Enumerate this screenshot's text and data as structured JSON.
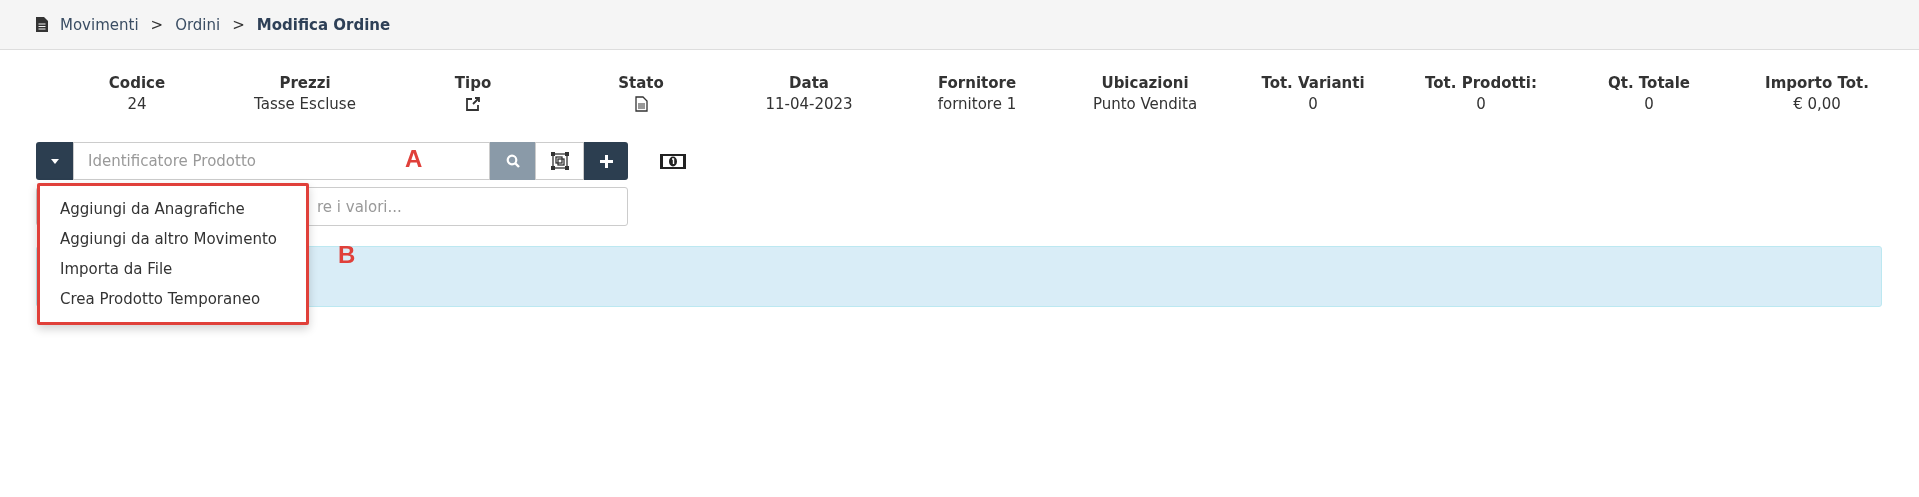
{
  "breadcrumb": [
    {
      "label": "Movimenti",
      "current": false
    },
    {
      "label": "Ordini",
      "current": false
    },
    {
      "label": "Modifica Ordine",
      "current": true
    }
  ],
  "summary": [
    {
      "label": "Codice",
      "kind": "text",
      "value": "24"
    },
    {
      "label": "Prezzi",
      "kind": "text",
      "value": "Tasse Escluse"
    },
    {
      "label": "Tipo",
      "kind": "link"
    },
    {
      "label": "Stato",
      "kind": "document"
    },
    {
      "label": "Data",
      "kind": "text",
      "value": "11-04-2023"
    },
    {
      "label": "Fornitore",
      "kind": "text",
      "value": "fornitore 1"
    },
    {
      "label": "Ubicazioni",
      "kind": "text",
      "value": "Punto Vendita"
    },
    {
      "label": "Tot. Varianti",
      "kind": "text",
      "value": "0"
    },
    {
      "label": "Tot. Prodotti:",
      "kind": "text",
      "value": "0"
    },
    {
      "label": "Qt. Totale",
      "kind": "text",
      "value": "0"
    },
    {
      "label": "Importo Tot.",
      "kind": "text",
      "value": "€ 0,00"
    }
  ],
  "breadcrumb_separators": [
    ">",
    ">"
  ],
  "search": {
    "placeholder": "Identificatore Prodotto"
  },
  "filter": {
    "placeholder": "re i valori..."
  },
  "menu": [
    "Aggiungi da Anagrafiche",
    "Aggiungi da altro Movimento",
    "Importa da File",
    "Crea Prodotto Temporaneo"
  ],
  "annotations": [
    "A",
    "B"
  ]
}
